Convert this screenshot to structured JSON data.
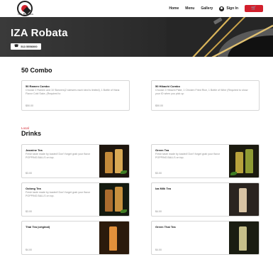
{
  "header": {
    "logo_text": "Iza Robata",
    "nav": [
      "Home",
      "Menu",
      "Gallery"
    ],
    "signin_label": "Sign In",
    "cart_icon": "cart-icon",
    "accent_color": "#d21f2c"
  },
  "hero": {
    "title": "IZA Robata",
    "phone": "513 5556000"
  },
  "combo": {
    "title": "50 Combo",
    "items": [
      {
        "name": "50 Ramen Combo",
        "desc": "Choose 2 Ramen and 10 Skewers(2 skewers each kind is limited), 1 Bottle of Hana Flavor Cold Sake, (Required to",
        "price": "$50.00"
      },
      {
        "name": "50 Hibachi Combo",
        "desc": "Choose 2 Hibachi Plate, 1 Chicken Fried Rice, 1 Bottle of Wine (Required to show your ID when you pick up",
        "price": "$50.00"
      }
    ]
  },
  "drinks": {
    "label": "Local",
    "title": "Drinks",
    "items": [
      {
        "name": "Jasmine Tea",
        "desc": "Fresh taste made by loaded! Don't forget grab your flavor POPPING BALLS on top.",
        "price": "$3.00"
      },
      {
        "name": "Green Tea",
        "desc": "Fresh taste made by loaded! Don't forget grab your flavor POPPING BALLS on top.",
        "price": "$3.00"
      },
      {
        "name": "Oolong Tea",
        "desc": "Fresh taste made by loaded! Don't forget grab your flavor POPPING BALLS on top.",
        "price": "$3.00"
      },
      {
        "name": "Iza Milk Tea",
        "desc": "",
        "price": "$4.00"
      },
      {
        "name": "Thai Tea (original)",
        "desc": "",
        "price": "$4.00"
      },
      {
        "name": "Green Thai Tea",
        "desc": "",
        "price": "$4.00"
      }
    ]
  }
}
